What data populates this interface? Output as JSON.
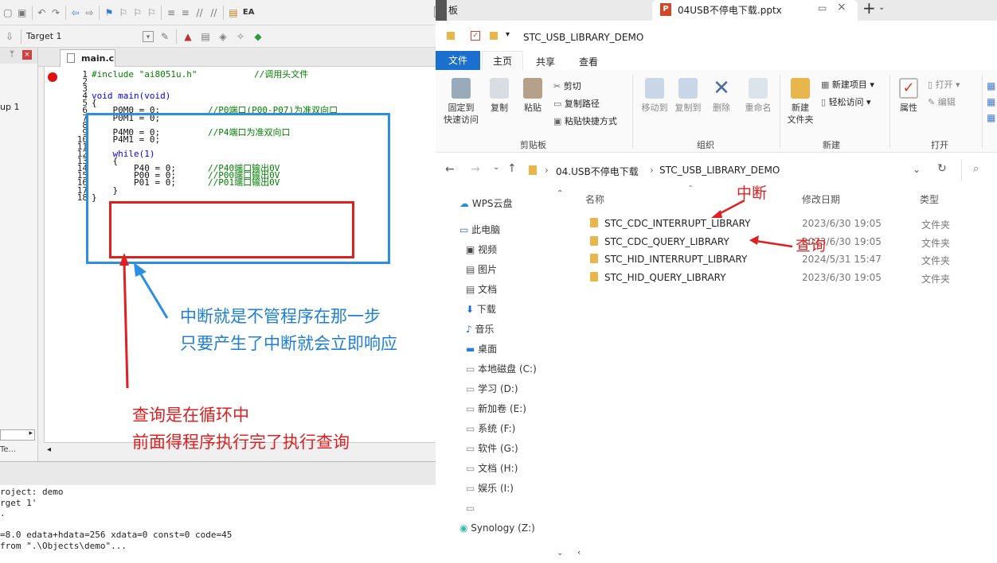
{
  "ide": {
    "toolbar1_text": "EA",
    "target": "Target 1",
    "panel_text": "up 1",
    "panel_tab": "Te...",
    "file_tab": "main.c",
    "line_numbers": [
      "1",
      "2",
      "3",
      "4",
      "5",
      "6",
      "7",
      "8",
      "9",
      "10",
      "11",
      "12",
      "13",
      "14",
      "15",
      "16",
      "17",
      "18"
    ],
    "code": [
      {
        "t": "#include \"ai8051u.h\"",
        "c": "//调用头文件"
      },
      {
        "t": "",
        "c": ""
      },
      {
        "t": "",
        "c": ""
      },
      {
        "t": "void main(void)",
        "c": ""
      },
      {
        "t": "{",
        "c": ""
      },
      {
        "t": "    P0M0 = 0;",
        "c": "//P0端口(P00-P07)为准双向口"
      },
      {
        "t": "    P0M1 = 0;",
        "c": ""
      },
      {
        "t": "",
        "c": ""
      },
      {
        "t": "    P4M0 = 0;",
        "c": "//P4端口为准双向口"
      },
      {
        "t": "    P4M1 = 0;",
        "c": ""
      },
      {
        "t": "",
        "c": ""
      },
      {
        "t": "    while(1)",
        "c": ""
      },
      {
        "t": "    {",
        "c": ""
      },
      {
        "t": "        P40 = 0;",
        "c": "//P40端口输出0V"
      },
      {
        "t": "        P00 = 0;",
        "c": "//P00端口输出0V"
      },
      {
        "t": "        P01 = 0;",
        "c": "//P01端口输出0V"
      },
      {
        "t": "    }",
        "c": ""
      },
      {
        "t": "}",
        "c": ""
      }
    ],
    "output": [
      "roject: demo",
      "rget 1'",
      ".",
      "",
      "=8.0 edata+hdata=256 xdata=0 const=0 code=45",
      "from \".\\Objects\\demo\"..."
    ]
  },
  "annotations": {
    "blue_line1": "中断就是不管程序在那一步",
    "blue_line2": "只要产生了中断就会立即响应",
    "red_line1": "查询是在循环中",
    "red_line2": "前面得程序执行完了执行查询",
    "interrupt_label": "中断",
    "query_label": "查询"
  },
  "explorer": {
    "tabs": {
      "prev_tab": "板",
      "active_tab": "04USB不停电下载.pptx"
    },
    "title": "STC_USB_LIBRARY_DEMO",
    "ribbon_tabs": [
      "文件",
      "主页",
      "共享",
      "查看"
    ],
    "ribbon": {
      "pin": "固定到\n快速访问",
      "copy": "复制",
      "paste": "粘贴",
      "cut": "剪切",
      "copy_path": "复制路径",
      "paste_shortcut": "粘贴快捷方式",
      "move_to": "移动到",
      "copy_to": "复制到",
      "delete": "删除",
      "rename": "重命名",
      "new_folder": "新建\n文件夹",
      "new_item": "新建项目 ▾",
      "easy_access": "轻松访问 ▾",
      "properties": "属性",
      "open": "打开 ▾",
      "edit": "编辑",
      "group_clipboard": "剪贴板",
      "group_organize": "组织",
      "group_new": "新建",
      "group_open": "打开"
    },
    "breadcrumb": [
      "04.USB不停电下载",
      "STC_USB_LIBRARY_DEMO"
    ],
    "columns": {
      "name": "名称",
      "date": "修改日期",
      "type": "类型"
    },
    "nav": [
      "WPS云盘",
      "此电脑",
      "视频",
      "图片",
      "文档",
      "下载",
      "音乐",
      "桌面",
      "本地磁盘 (C:)",
      "学习 (D:)",
      "新加卷 (E:)",
      "系统 (F:)",
      "软件 (G:)",
      "文档 (H:)",
      "娱乐 (I:)",
      "",
      "Synology (Z:)"
    ],
    "files": [
      {
        "name": "STC_CDC_INTERRUPT_LIBRARY",
        "date": "2023/6/30 19:05",
        "type": "文件夹"
      },
      {
        "name": "STC_CDC_QUERY_LIBRARY",
        "date": "2023/6/30 19:05",
        "type": "文件夹"
      },
      {
        "name": "STC_HID_INTERRUPT_LIBRARY",
        "date": "2024/5/31 15:47",
        "type": "文件夹"
      },
      {
        "name": "STC_HID_QUERY_LIBRARY",
        "date": "2023/6/30 19:05",
        "type": "文件夹"
      }
    ]
  }
}
